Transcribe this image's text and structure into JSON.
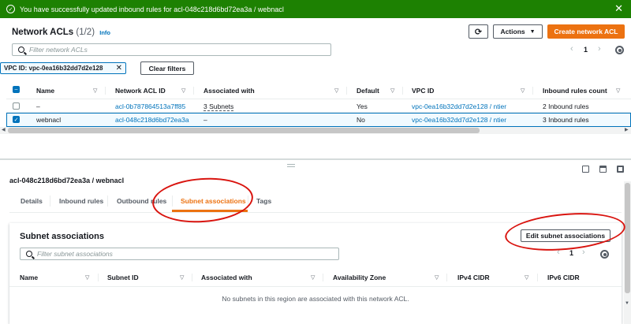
{
  "flash": {
    "message": "You have successfully updated inbound rules for acl-048c218d6bd72ea3a / webnacl"
  },
  "header": {
    "title": "Network ACLs",
    "count": "(1/2)",
    "info": "Info"
  },
  "toolbar": {
    "actions_label": "Actions",
    "create_label": "Create network ACL"
  },
  "search": {
    "placeholder": "Filter network ACLs"
  },
  "pagination": {
    "page": "1"
  },
  "filter": {
    "token": "VPC ID: vpc-0ea16b32dd7d2e128",
    "clear_label": "Clear filters"
  },
  "table": {
    "columns": [
      "Name",
      "Network ACL ID",
      "Associated with",
      "Default",
      "VPC ID",
      "Inbound rules count"
    ],
    "rows": [
      {
        "name": "–",
        "acl_id": "acl-0b787864513a7ff85",
        "associated": "3 Subnets",
        "default": "Yes",
        "vpc": "vpc-0ea16b32dd7d2e128 / ntier",
        "inbound": "2 Inbound rules"
      },
      {
        "name": "webnacl",
        "acl_id": "acl-048c218d6bd72ea3a",
        "associated": "–",
        "default": "No",
        "vpc": "vpc-0ea16b32dd7d2e128 / ntier",
        "inbound": "3 Inbound rules"
      }
    ]
  },
  "detail": {
    "title": "acl-048c218d6bd72ea3a / webnacl",
    "tabs": [
      "Details",
      "Inbound rules",
      "Outbound rules",
      "Subnet associations",
      "Tags"
    ],
    "active_tab": "Subnet associations",
    "panel_title": "Subnet associations",
    "edit_label": "Edit subnet associations",
    "search_placeholder": "Filter subnet associations",
    "page": "1",
    "columns": [
      "Name",
      "Subnet ID",
      "Associated with",
      "Availability Zone",
      "IPv4 CIDR",
      "IPv6 CIDR"
    ],
    "empty_message": "No subnets in this region are associated with this network ACL."
  },
  "colors": {
    "flash_bg": "#1d8102",
    "primary": "#ec7211",
    "link": "#0073bb",
    "annotation": "#d9140f"
  }
}
